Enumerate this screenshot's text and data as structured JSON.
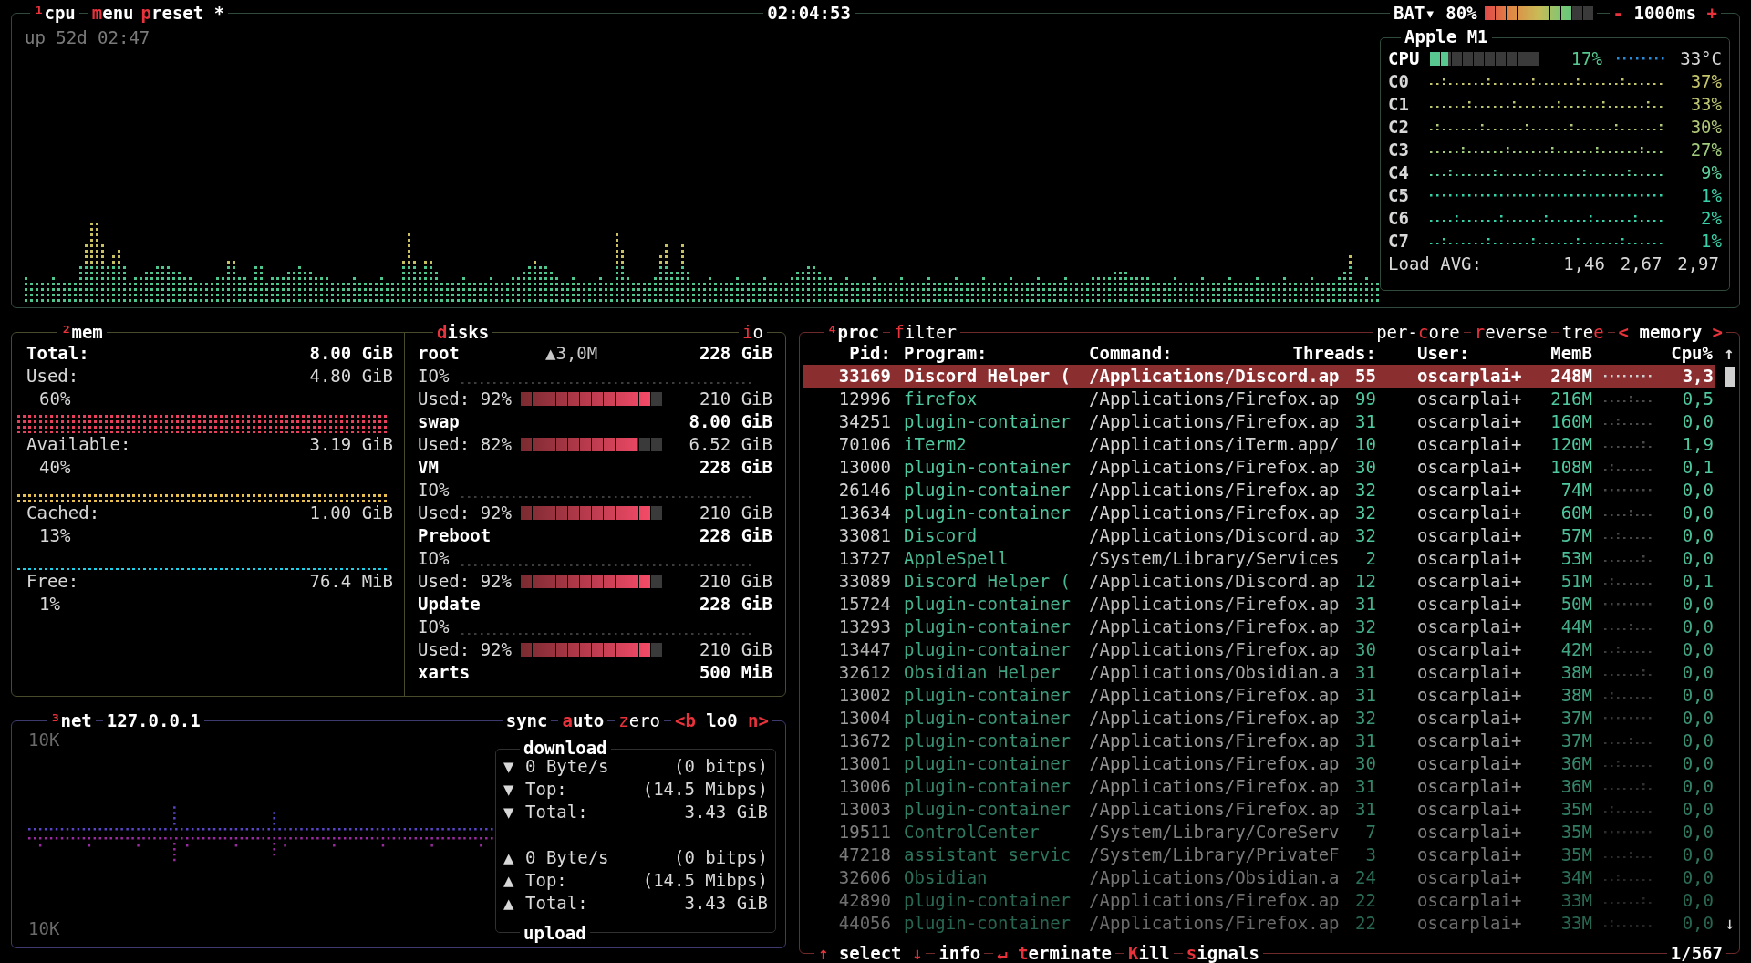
{
  "cpu_panel": {
    "title": [
      {
        "text": "¹",
        "hot": true
      },
      {
        "text": "cpu",
        "hot": false
      }
    ],
    "menu": [
      {
        "text": "m",
        "hot": true
      },
      {
        "text": "enu",
        "hot": false
      }
    ],
    "preset": [
      {
        "text": "p",
        "hot": true
      },
      {
        "text": "reset *",
        "hot": false
      }
    ],
    "clock": "02:04:53",
    "battery": {
      "label": "BAT▾ 80%",
      "level": 0.8
    },
    "interval": [
      {
        "text": "-",
        "hot": true
      },
      {
        "text": " 1000ms ",
        "hot": false
      },
      {
        "text": "+",
        "hot": true
      }
    ],
    "uptime": "up 52d 02:47",
    "info": {
      "title": "Apple M1",
      "cpu_label": "CPU",
      "level": 0.17,
      "percent": "17%",
      "temp": "33°C",
      "cores": [
        {
          "label": "C0",
          "percent": "37%",
          "color": "#c4c46c"
        },
        {
          "label": "C1",
          "percent": "33%",
          "color": "#bcc470"
        },
        {
          "label": "C2",
          "percent": "30%",
          "color": "#b0c878"
        },
        {
          "label": "C3",
          "percent": "27%",
          "color": "#a0cc7c"
        },
        {
          "label": "C4",
          "percent": "9%",
          "color": "#5cd09c"
        },
        {
          "label": "C5",
          "percent": "1%",
          "color": "#38d0a8"
        },
        {
          "label": "C6",
          "percent": "2%",
          "color": "#38d0a8"
        },
        {
          "label": "C7",
          "percent": "1%",
          "color": "#38d0a8"
        }
      ],
      "load_label": "Load AVG:",
      "load": [
        "1,46",
        "2,67",
        "2,97"
      ]
    }
  },
  "mem_panel": {
    "title": [
      {
        "text": "²",
        "hot": true
      },
      {
        "text": "mem",
        "hot": false
      }
    ],
    "total": {
      "label": "Total:",
      "value": "8.00 GiB"
    },
    "items": [
      {
        "label": "Used:",
        "value": "4.80 GiB",
        "percent": "60%",
        "color": "#e8405c"
      },
      {
        "label": "Available:",
        "value": "3.19 GiB",
        "percent": "40%",
        "color": "#e8c050"
      },
      {
        "label": "Cached:",
        "value": "1.00 GiB",
        "percent": "13%",
        "color": "#20d0e8"
      },
      {
        "label": "Free:",
        "value": "76.4 MiB",
        "percent": "1%"
      }
    ]
  },
  "disks": {
    "title": [
      {
        "text": "d",
        "hot": true
      },
      {
        "text": "isks",
        "hot": false
      }
    ],
    "io_toggle": [
      {
        "text": "i",
        "hot": true
      },
      {
        "text": "o",
        "hot": false
      }
    ],
    "items": [
      {
        "name": "root",
        "io": "▲3,0M",
        "size": "228 GiB",
        "io_label": "IO%",
        "used_label": "Used: 92%",
        "level": 0.92,
        "used": "210 GiB"
      },
      {
        "name": "swap",
        "size": "8.00 GiB",
        "used_label": "Used: 82%",
        "level": 0.82,
        "used": "6.52 GiB"
      },
      {
        "name": "VM",
        "size": "228 GiB",
        "io_label": "IO%",
        "used_label": "Used: 92%",
        "level": 0.92,
        "used": "210 GiB"
      },
      {
        "name": "Preboot",
        "size": "228 GiB",
        "io_label": "IO%",
        "used_label": "Used: 92%",
        "level": 0.92,
        "used": "210 GiB"
      },
      {
        "name": "Update",
        "size": "228 GiB",
        "io_label": "IO%",
        "used_label": "Used: 92%",
        "level": 0.92,
        "used": "210 GiB"
      },
      {
        "name": "xarts",
        "size": "500 MiB"
      }
    ]
  },
  "net_panel": {
    "title": [
      {
        "text": "³",
        "hot": true
      },
      {
        "text": "net",
        "hot": false
      }
    ],
    "address": "127.0.0.1",
    "toggles": [
      [
        {
          "text": "sync",
          "hot": false
        }
      ],
      [
        {
          "text": "a",
          "hot": true
        },
        {
          "text": "uto",
          "hot": false
        }
      ],
      [
        {
          "text": "z",
          "hot": true
        },
        {
          "text": "ero",
          "hot": false
        }
      ],
      [
        {
          "text": "<b",
          "hot": true
        },
        {
          "text": " lo0 ",
          "hot": false
        },
        {
          "text": "n>",
          "hot": true
        }
      ]
    ],
    "scale_top": "10K",
    "scale_bottom": "10K",
    "download": {
      "title": "download",
      "rows": [
        {
          "arrow": "▼",
          "label": "0 Byte/s",
          "value": "(0 bitps)"
        },
        {
          "arrow": "▼",
          "label": "Top:",
          "value": "(14.5 Mibps)"
        },
        {
          "arrow": "▼",
          "label": "Total:",
          "value": "3.43 GiB"
        }
      ]
    },
    "upload": {
      "title": "upload",
      "rows": [
        {
          "arrow": "▲",
          "label": "0 Byte/s",
          "value": "(0 bitps)"
        },
        {
          "arrow": "▲",
          "label": "Top:",
          "value": "(14.5 Mibps)"
        },
        {
          "arrow": "▲",
          "label": "Total:",
          "value": "3.43 GiB"
        }
      ]
    }
  },
  "proc_panel": {
    "title": [
      {
        "text": "⁴",
        "hot": true
      },
      {
        "text": "proc",
        "hot": false
      }
    ],
    "filter": [
      {
        "text": "f",
        "hot": true
      },
      {
        "text": "ilter",
        "hot": false
      }
    ],
    "toggles": [
      [
        {
          "text": "per-",
          "hot": false
        },
        {
          "text": "c",
          "hot": true
        },
        {
          "text": "ore",
          "hot": false
        }
      ],
      [
        {
          "text": "r",
          "hot": true
        },
        {
          "text": "everse",
          "hot": false
        }
      ],
      [
        {
          "text": "tre",
          "hot": false
        },
        {
          "text": "e",
          "hot": true
        }
      ],
      [
        {
          "text": "<",
          "hot": true
        },
        {
          "text": " memory ",
          "hot": false
        },
        {
          "text": ">",
          "hot": true
        }
      ]
    ],
    "columns": [
      "Pid:",
      "Program:",
      "Command:",
      "Threads:",
      "User:",
      "MemB",
      "Cpu%"
    ],
    "scroll_up": "↑",
    "scroll_down": "↓",
    "rows": [
      {
        "pid": "33169",
        "program": "Discord Helper (",
        "command": "/Applications/Discord.ap",
        "threads": "55",
        "user": "oscarplai+",
        "mem": "248M",
        "cpu": "3,3",
        "selected": true
      },
      {
        "pid": "12996",
        "program": "firefox",
        "command": "/Applications/Firefox.ap",
        "threads": "99",
        "user": "oscarplai+",
        "mem": "216M",
        "cpu": "0,5",
        "selected": false
      },
      {
        "pid": "34251",
        "program": "plugin-container",
        "command": "/Applications/Firefox.ap",
        "threads": "31",
        "user": "oscarplai+",
        "mem": "160M",
        "cpu": "0,0",
        "selected": false
      },
      {
        "pid": "70106",
        "program": "iTerm2",
        "command": "/Applications/iTerm.app/",
        "threads": "10",
        "user": "oscarplai+",
        "mem": "120M",
        "cpu": "1,9",
        "selected": false
      },
      {
        "pid": "13000",
        "program": "plugin-container",
        "command": "/Applications/Firefox.ap",
        "threads": "30",
        "user": "oscarplai+",
        "mem": "108M",
        "cpu": "0,1",
        "selected": false
      },
      {
        "pid": "26146",
        "program": "plugin-container",
        "command": "/Applications/Firefox.ap",
        "threads": "32",
        "user": "oscarplai+",
        "mem": "74M",
        "cpu": "0,0",
        "selected": false
      },
      {
        "pid": "13634",
        "program": "plugin-container",
        "command": "/Applications/Firefox.ap",
        "threads": "32",
        "user": "oscarplai+",
        "mem": "60M",
        "cpu": "0,0",
        "selected": false
      },
      {
        "pid": "33081",
        "program": "Discord",
        "command": "/Applications/Discord.ap",
        "threads": "32",
        "user": "oscarplai+",
        "mem": "57M",
        "cpu": "0,0",
        "selected": false
      },
      {
        "pid": "13727",
        "program": "AppleSpell",
        "command": "/System/Library/Services",
        "threads": "2",
        "user": "oscarplai+",
        "mem": "53M",
        "cpu": "0,0",
        "selected": false
      },
      {
        "pid": "33089",
        "program": "Discord Helper (",
        "command": "/Applications/Discord.ap",
        "threads": "12",
        "user": "oscarplai+",
        "mem": "51M",
        "cpu": "0,1",
        "selected": false
      },
      {
        "pid": "15724",
        "program": "plugin-container",
        "command": "/Applications/Firefox.ap",
        "threads": "31",
        "user": "oscarplai+",
        "mem": "50M",
        "cpu": "0,0",
        "selected": false
      },
      {
        "pid": "13293",
        "program": "plugin-container",
        "command": "/Applications/Firefox.ap",
        "threads": "32",
        "user": "oscarplai+",
        "mem": "44M",
        "cpu": "0,0",
        "selected": false
      },
      {
        "pid": "13447",
        "program": "plugin-container",
        "command": "/Applications/Firefox.ap",
        "threads": "30",
        "user": "oscarplai+",
        "mem": "42M",
        "cpu": "0,0",
        "selected": false
      },
      {
        "pid": "32612",
        "program": "Obsidian Helper",
        "command": "/Applications/Obsidian.a",
        "threads": "31",
        "user": "oscarplai+",
        "mem": "38M",
        "cpu": "0,0",
        "selected": false
      },
      {
        "pid": "13002",
        "program": "plugin-container",
        "command": "/Applications/Firefox.ap",
        "threads": "31",
        "user": "oscarplai+",
        "mem": "38M",
        "cpu": "0,0",
        "selected": false
      },
      {
        "pid": "13004",
        "program": "plugin-container",
        "command": "/Applications/Firefox.ap",
        "threads": "32",
        "user": "oscarplai+",
        "mem": "37M",
        "cpu": "0,0",
        "selected": false
      },
      {
        "pid": "13672",
        "program": "plugin-container",
        "command": "/Applications/Firefox.ap",
        "threads": "31",
        "user": "oscarplai+",
        "mem": "37M",
        "cpu": "0,0",
        "selected": false
      },
      {
        "pid": "13001",
        "program": "plugin-container",
        "command": "/Applications/Firefox.ap",
        "threads": "30",
        "user": "oscarplai+",
        "mem": "36M",
        "cpu": "0,0",
        "selected": false
      },
      {
        "pid": "13006",
        "program": "plugin-container",
        "command": "/Applications/Firefox.ap",
        "threads": "31",
        "user": "oscarplai+",
        "mem": "36M",
        "cpu": "0,0",
        "selected": false
      },
      {
        "pid": "13003",
        "program": "plugin-container",
        "command": "/Applications/Firefox.ap",
        "threads": "31",
        "user": "oscarplai+",
        "mem": "35M",
        "cpu": "0,0",
        "selected": false
      },
      {
        "pid": "19511",
        "program": "ControlCenter",
        "command": "/System/Library/CoreServ",
        "threads": "7",
        "user": "oscarplai+",
        "mem": "35M",
        "cpu": "0,0",
        "selected": false
      },
      {
        "pid": "47218",
        "program": "assistant_servic",
        "command": "/System/Library/PrivateF",
        "threads": "3",
        "user": "oscarplai+",
        "mem": "35M",
        "cpu": "0,0",
        "selected": false
      },
      {
        "pid": "32606",
        "program": "Obsidian",
        "command": "/Applications/Obsidian.a",
        "threads": "24",
        "user": "oscarplai+",
        "mem": "34M",
        "cpu": "0,0",
        "selected": false
      },
      {
        "pid": "42890",
        "program": "plugin-container",
        "command": "/Applications/Firefox.ap",
        "threads": "22",
        "user": "oscarplai+",
        "mem": "33M",
        "cpu": "0,0",
        "selected": false
      },
      {
        "pid": "44056",
        "program": "plugin-container",
        "command": "/Applications/Firefox.ap",
        "threads": "22",
        "user": "oscarplai+",
        "mem": "33M",
        "cpu": "0,0",
        "selected": false
      }
    ],
    "footer": [
      [
        {
          "text": "↑",
          "hot": true
        },
        {
          "text": " select ",
          "hot": false
        },
        {
          "text": "↓",
          "hot": true
        }
      ],
      [
        {
          "text": "info",
          "hot": false
        }
      ],
      [
        {
          "text": "↵ t",
          "hot": true
        },
        {
          "text": "erminate",
          "hot": false
        }
      ],
      [
        {
          "text": "K",
          "hot": true
        },
        {
          "text": "ill",
          "hot": false
        }
      ],
      [
        {
          "text": "s",
          "hot": true
        },
        {
          "text": "ignals",
          "hot": false
        }
      ]
    ],
    "count": "1/567"
  }
}
